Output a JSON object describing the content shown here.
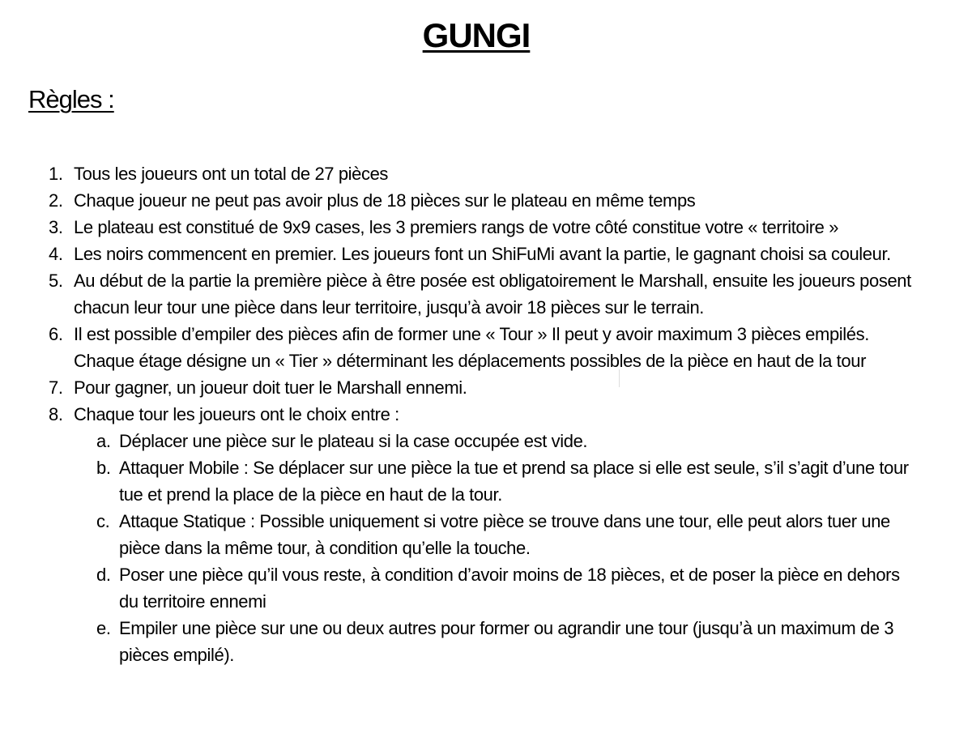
{
  "document": {
    "title": "GUNGI",
    "subtitle": "Règles :",
    "rules": [
      {
        "number": "1.",
        "text": "Tous les joueurs ont un total de 27 pièces"
      },
      {
        "number": "2.",
        "text": "Chaque joueur ne peut pas avoir plus de 18 pièces sur le plateau en même temps"
      },
      {
        "number": "3.",
        "text": "Le plateau est constitué de 9x9 cases, les 3 premiers rangs de votre côté constitue votre « territoire »"
      },
      {
        "number": "4.",
        "text": "Les noirs commencent en premier. Les joueurs font un ShiFuMi avant la partie, le gagnant choisi sa couleur."
      },
      {
        "number": "5.",
        "text": "Au début de la partie la première pièce à être posée est obligatoirement le Marshall, ensuite les joueurs posent chacun leur tour une pièce dans leur territoire, jusqu’à avoir 18 pièces sur le terrain."
      },
      {
        "number": "6.",
        "text": "Il est possible d’empiler des pièces afin de former une « Tour » Il peut y avoir maximum 3 pièces empilés. Chaque étage désigne un « Tier » déterminant les déplacements possibles de la pièce en haut de la tour"
      },
      {
        "number": "7.",
        "text": "Pour gagner, un joueur doit tuer le Marshall ennemi."
      },
      {
        "number": "8.",
        "text": "Chaque tour les joueurs ont le choix entre :"
      }
    ],
    "choices": [
      {
        "letter": "a.",
        "text": "Déplacer une pièce sur le plateau si la case occupée est vide."
      },
      {
        "letter": "b.",
        "text": " Attaquer Mobile : Se déplacer sur une pièce la tue et prend sa place si elle est seule, s’il s’agit d’une tour tue et prend la place de la pièce en haut de la tour."
      },
      {
        "letter": "c.",
        "text": "Attaque Statique :  Possible uniquement si votre pièce se trouve dans une tour, elle peut alors tuer une pièce dans la même tour, à condition qu’elle la touche."
      },
      {
        "letter": "d.",
        "text": "Poser une pièce qu’il vous reste, à condition d’avoir moins de 18 pièces, et de poser la pièce en dehors du territoire ennemi"
      },
      {
        "letter": "e.",
        "text": "Empiler une pièce sur une ou deux autres pour former ou agrandir une tour (jusqu’à un maximum de 3 pièces empilé)."
      }
    ]
  }
}
